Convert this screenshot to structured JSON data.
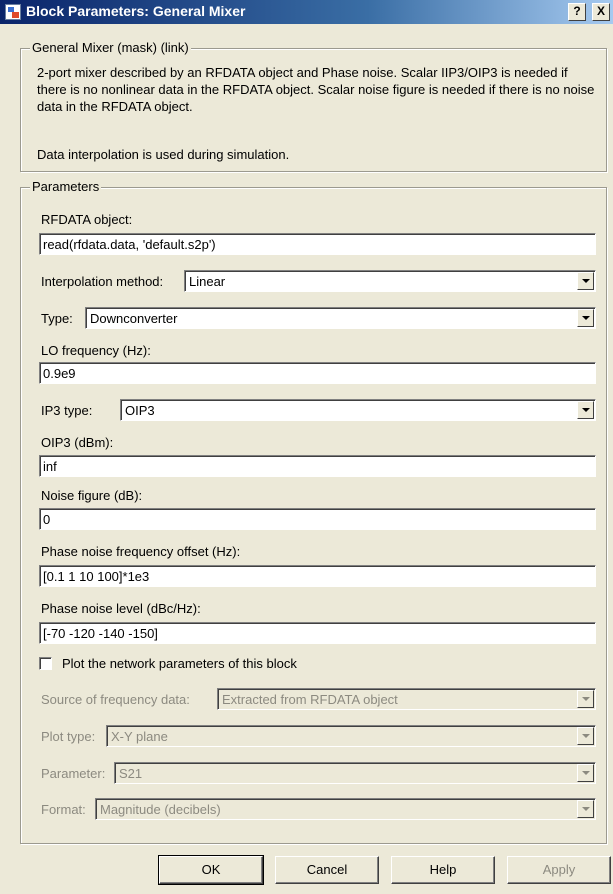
{
  "window": {
    "title": "Block Parameters: General Mixer",
    "help_button": "?",
    "close_button": "X"
  },
  "mask_group": {
    "legend": "General Mixer (mask) (link)",
    "description": "2-port mixer described by an RFDATA object and Phase noise. Scalar IIP3/OIP3 is needed if there is no nonlinear data in the RFDATA object.  Scalar noise figure is needed if there is no noise data in the RFDATA object.",
    "note": "Data interpolation is used during simulation."
  },
  "parameters": {
    "legend": "Parameters",
    "rfdata_label": "RFDATA object:",
    "rfdata_value": "read(rfdata.data, 'default.s2p')",
    "interp_label": "Interpolation method:",
    "interp_value": "Linear",
    "type_label": "Type:",
    "type_value": "Downconverter",
    "lo_label": "LO frequency (Hz):",
    "lo_value": "0.9e9",
    "ip3type_label": "IP3 type:",
    "ip3type_value": "OIP3",
    "oip3_label": "OIP3 (dBm):",
    "oip3_value": "inf",
    "nf_label": "Noise figure (dB):",
    "nf_value": "0",
    "pn_offset_label": "Phase noise frequency offset (Hz):",
    "pn_offset_value": "[0.1 1 10 100]*1e3",
    "pn_level_label": "Phase noise level (dBc/Hz):",
    "pn_level_value": "[-70 -120 -140 -150]",
    "plot_checkbox_label": "Plot the network parameters of this block",
    "plot_checked": false,
    "freq_source_label": "Source of frequency data:",
    "freq_source_value": "Extracted from RFDATA object",
    "plot_type_label": "Plot type:",
    "plot_type_value": "X-Y plane",
    "parameter_label": "Parameter:",
    "parameter_value": "S21",
    "format_label": "Format:",
    "format_value": "Magnitude (decibels)"
  },
  "buttons": {
    "ok": "OK",
    "cancel": "Cancel",
    "help": "Help",
    "apply": "Apply"
  },
  "colors": {
    "dialog_bg": "#ece9d8",
    "titlebar_start": "#0a246a",
    "titlebar_end": "#a6caf0",
    "disabled_text": "#8c8a80"
  }
}
